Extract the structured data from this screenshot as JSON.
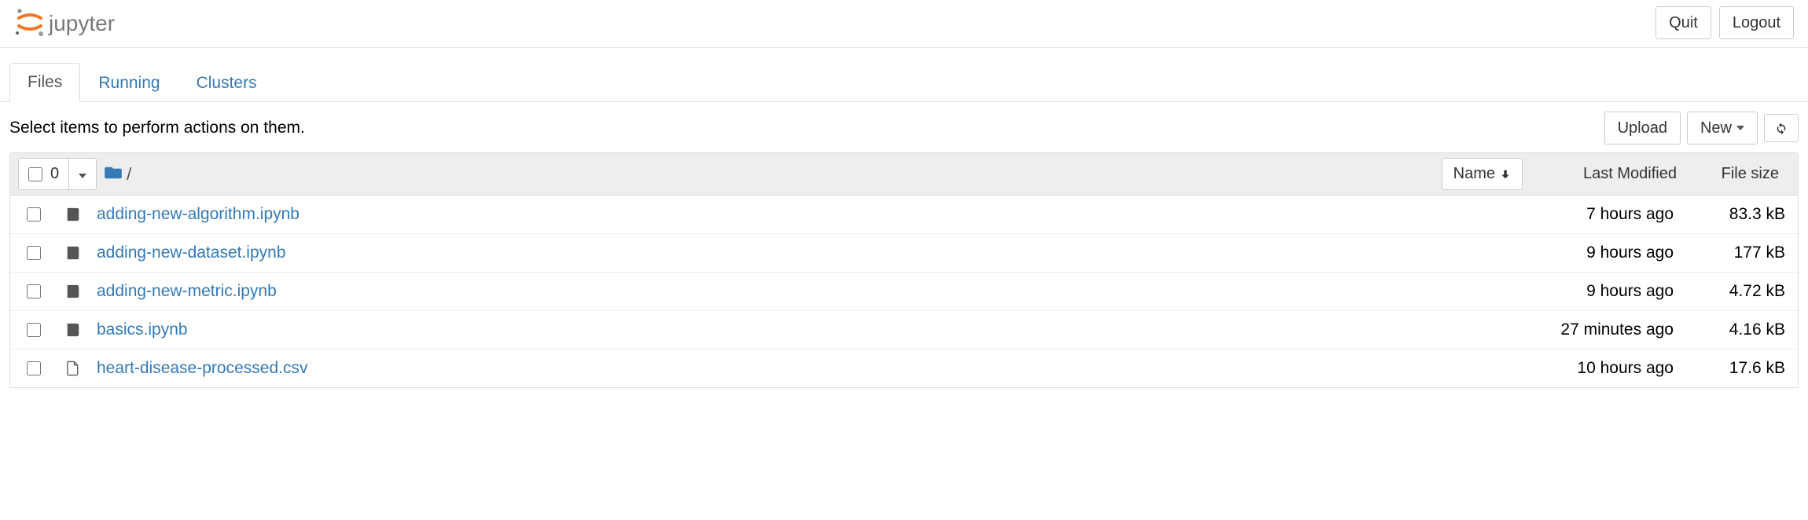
{
  "header": {
    "brand": "jupyter",
    "quit_label": "Quit",
    "logout_label": "Logout"
  },
  "tabs": [
    {
      "label": "Files",
      "active": true
    },
    {
      "label": "Running",
      "active": false
    },
    {
      "label": "Clusters",
      "active": false
    }
  ],
  "toolbar": {
    "hint": "Select items to perform actions on them.",
    "upload_label": "Upload",
    "new_label": "New"
  },
  "list_header": {
    "selected_count": "0",
    "breadcrumb_root": "/",
    "col_name": "Name",
    "col_modified": "Last Modified",
    "col_size": "File size"
  },
  "files": [
    {
      "icon": "notebook",
      "name": "adding-new-algorithm.ipynb",
      "modified": "7 hours ago",
      "size": "83.3 kB"
    },
    {
      "icon": "notebook",
      "name": "adding-new-dataset.ipynb",
      "modified": "9 hours ago",
      "size": "177 kB"
    },
    {
      "icon": "notebook",
      "name": "adding-new-metric.ipynb",
      "modified": "9 hours ago",
      "size": "4.72 kB"
    },
    {
      "icon": "notebook",
      "name": "basics.ipynb",
      "modified": "27 minutes ago",
      "size": "4.16 kB"
    },
    {
      "icon": "file",
      "name": "heart-disease-processed.csv",
      "modified": "10 hours ago",
      "size": "17.6 kB"
    }
  ]
}
